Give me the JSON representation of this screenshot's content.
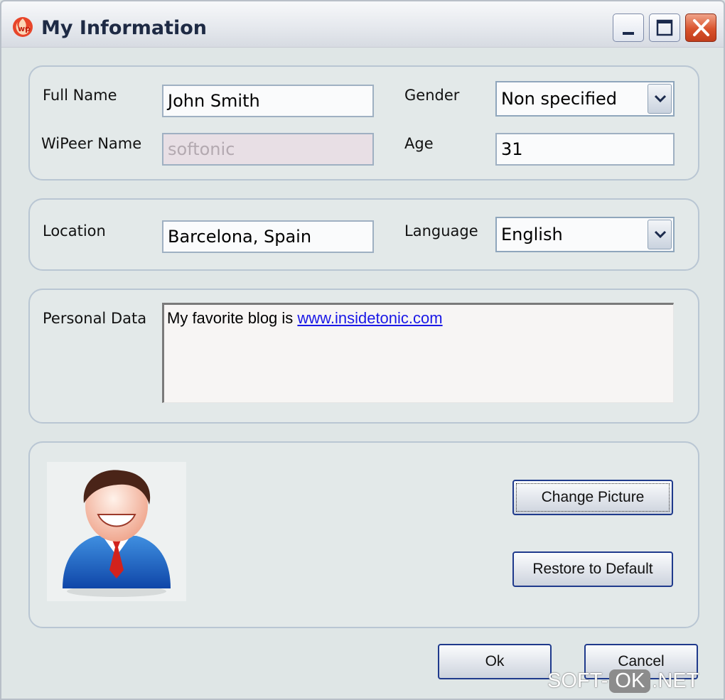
{
  "window": {
    "title": "My Information",
    "app_icon": "wipeer-logo-icon"
  },
  "profile": {
    "full_name_label": "Full Name",
    "full_name_value": "John Smith",
    "wipeer_name_label": "WiPeer Name",
    "wipeer_name_value": "softonic",
    "gender_label": "Gender",
    "gender_value": "Non specified",
    "age_label": "Age",
    "age_value": "31"
  },
  "location": {
    "location_label": "Location",
    "location_value": "Barcelona, Spain",
    "language_label": "Language",
    "language_value": "English"
  },
  "personal": {
    "label": "Personal Data",
    "text_prefix": "My favorite blog is ",
    "link_text": "www.insidetonic.com"
  },
  "picture": {
    "avatar_icon": "user-avatar-icon",
    "change_label": "Change Picture",
    "restore_label": "Restore to Default"
  },
  "footer": {
    "ok_label": "Ok",
    "cancel_label": "Cancel"
  },
  "watermark": {
    "part1": "SOFT-",
    "part2": "OK",
    "part3": ".NET"
  }
}
